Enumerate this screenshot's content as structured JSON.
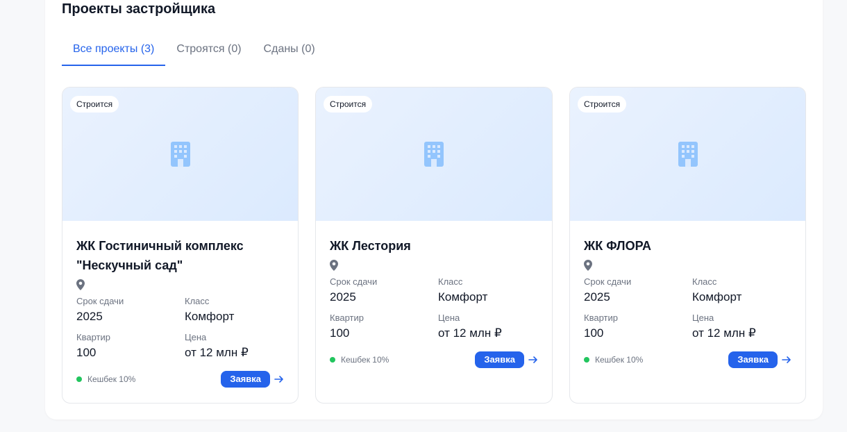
{
  "section": {
    "title": "Проекты застройщика"
  },
  "tabs": [
    {
      "label": "Все проекты (3)",
      "active": true
    },
    {
      "label": "Строятся (0)",
      "active": false
    },
    {
      "label": "Сданы (0)",
      "active": false
    }
  ],
  "projects": [
    {
      "status": "Строится",
      "name": "ЖК Гостиничный комплекс \"Нескучный сад\"",
      "deadline_label": "Срок сдачи",
      "deadline": "2025",
      "class_label": "Класс",
      "class": "Комфорт",
      "flats_label": "Квартир",
      "flats": "100",
      "price_label": "Цена",
      "price": "от 12 млн ₽",
      "cashback": "Кешбек 10%",
      "cta": "Заявка"
    },
    {
      "status": "Строится",
      "name": "ЖК Лестория",
      "deadline_label": "Срок сдачи",
      "deadline": "2025",
      "class_label": "Класс",
      "class": "Комфорт",
      "flats_label": "Квартир",
      "flats": "100",
      "price_label": "Цена",
      "price": "от 12 млн ₽",
      "cashback": "Кешбек 10%",
      "cta": "Заявка"
    },
    {
      "status": "Строится",
      "name": "ЖК ФЛОРА",
      "deadline_label": "Срок сдачи",
      "deadline": "2025",
      "class_label": "Класс",
      "class": "Комфорт",
      "flats_label": "Квартир",
      "flats": "100",
      "price_label": "Цена",
      "price": "от 12 млн ₽",
      "cashback": "Кешбек 10%",
      "cta": "Заявка"
    }
  ],
  "icons": {
    "placeholder": "building-icon",
    "location": "map-pin-icon",
    "go": "arrow-right-icon"
  },
  "colors": {
    "accent": "#2563eb",
    "cashback_dot": "#22c55e",
    "icon_placeholder": "#93c5fd",
    "pin": "#6b7280"
  }
}
